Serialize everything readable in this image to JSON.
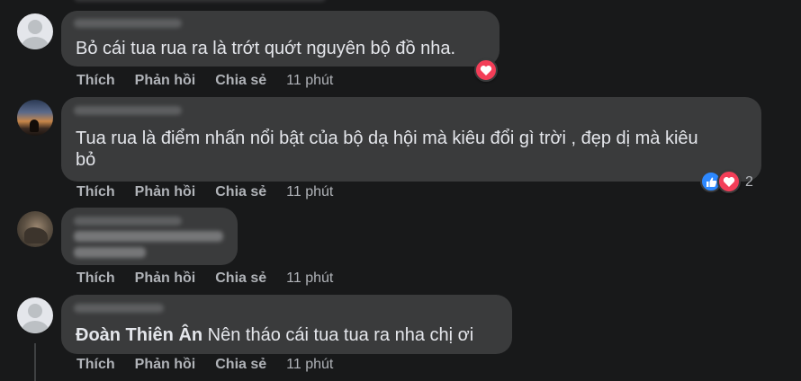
{
  "actions": {
    "like": "Thích",
    "reply": "Phản hồi",
    "share": "Chia sẻ"
  },
  "comments": [
    {
      "text": "Bỏ cái tua rua ra là trớt quớt nguyên bộ đồ nha.",
      "time": "11 phút",
      "reactions": [
        "heart"
      ]
    },
    {
      "text_line1": "Tua rua là điểm nhấn nổi bật của bộ dạ hội mà kiêu đổi gì trời , đẹp dị mà kiêu",
      "text_line2": "bỏ",
      "time": "11 phút",
      "reactions": [
        "like",
        "heart"
      ],
      "reaction_count": "2"
    },
    {
      "time": "11 phút"
    },
    {
      "tagged_name": "Đoàn Thiên Ân",
      "text": "Nên tháo cái tua tua ra nha chị ơi",
      "time": "11 phút"
    }
  ],
  "colors": {
    "background": "#18191a",
    "bubble": "#3a3b3c",
    "heart": "#f33e58",
    "like": "#2d88ff",
    "muted": "#b0b3b8"
  }
}
